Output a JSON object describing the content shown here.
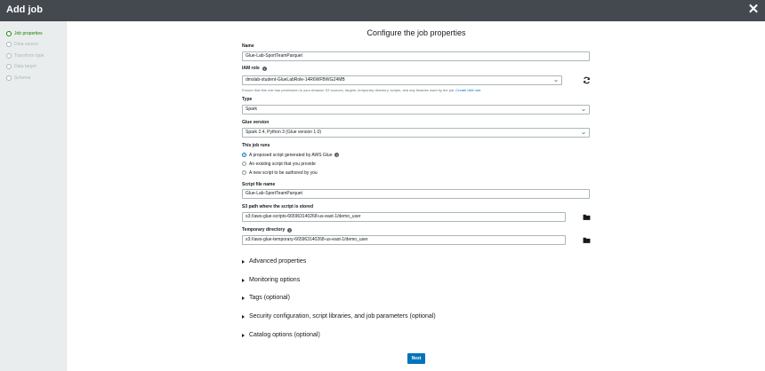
{
  "window": {
    "title": "Add job"
  },
  "sidebar": {
    "items": [
      {
        "label": "Job properties",
        "active": true
      },
      {
        "label": "Data source",
        "active": false
      },
      {
        "label": "Transform type",
        "active": false
      },
      {
        "label": "Data target",
        "active": false
      },
      {
        "label": "Schema",
        "active": false
      }
    ]
  },
  "form": {
    "heading": "Configure the job properties",
    "name": {
      "label": "Name",
      "value": "Glue-Lab-SportTeamParquet"
    },
    "iam_role": {
      "label": "IAM role",
      "value": "dmslab-student-GlueLabRole-14R6WFBWGZ4MB",
      "help_text": "Ensure that this role has permission to your Amazon S3 sources, targets, temporary directory, scripts, and any libraries used by the job.",
      "help_link": "Create IAM role."
    },
    "type": {
      "label": "Type",
      "value": "Spark"
    },
    "glue_version": {
      "label": "Glue version",
      "value": "Spark 2.4, Python 3 (Glue version 1.0)"
    },
    "job_runs": {
      "label": "This job runs",
      "options": [
        {
          "label": "A proposed script generated by AWS Glue",
          "selected": true
        },
        {
          "label": "An existing script that you provide",
          "selected": false
        },
        {
          "label": "A new script to be authored by you",
          "selected": false
        }
      ]
    },
    "script_file_name": {
      "label": "Script file name",
      "value": "Glue-Lab-SportTeamParquet"
    },
    "s3_path": {
      "label": "S3 path where the script is stored",
      "value": "s3://aws-glue-scripts-665963140268-us-east-1/demo_user"
    },
    "temp_dir": {
      "label": "Temporary directory",
      "value": "s3://aws-glue-temporary-665963140268-us-east-1/demo_user"
    }
  },
  "sections": [
    "Advanced properties",
    "Monitoring options",
    "Tags (optional)",
    "Security configuration, script libraries, and job parameters (optional)",
    "Catalog options (optional)"
  ],
  "actions": {
    "next_label": "Next"
  },
  "icons": {
    "close": "close-icon",
    "info": "info-icon",
    "refresh": "refresh-icon",
    "folder": "folder-icon",
    "caret": "chevron-down-icon",
    "expand": "caret-right-icon"
  },
  "colors": {
    "titlebar": "#44494f",
    "sidebar_bg": "#eaeded",
    "active_step": "#1d8102",
    "inactive_step": "#aab7b8",
    "primary": "#0073bb",
    "link": "#0073bb"
  }
}
